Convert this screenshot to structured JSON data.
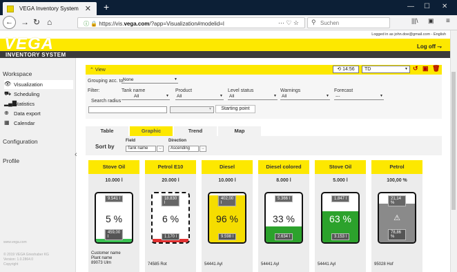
{
  "browser": {
    "tab_title": "VEGA Inventory System",
    "tab_close": "✕",
    "new_tab": "+",
    "url_prefix": "https://vis.",
    "url_domain": "vega.com",
    "url_path": "/?app=Visualization#modelid=l",
    "search_placeholder": "Suchen",
    "min": "—",
    "max": "☐",
    "close": "✕"
  },
  "header": {
    "logged_in": "Logged in as john.doe@gmail.com - English",
    "logo": "VEGA",
    "logoff": "Log off",
    "app_title": "INVENTORY SYSTEM"
  },
  "sidebar": {
    "workspace": "Workspace",
    "items": [
      {
        "label": "Visualization",
        "icon": "eye-icon"
      },
      {
        "label": "Scheduling",
        "icon": "truck-icon"
      },
      {
        "label": "Statistics",
        "icon": "bar-chart-icon"
      },
      {
        "label": "Data export",
        "icon": "export-icon"
      },
      {
        "label": "Calendar",
        "icon": "calendar-icon"
      }
    ],
    "configuration": "Configuration",
    "profile": "Profile",
    "footer_url": "www.vega.com",
    "footer_copy": "© 2019 VEGA Grieshaber KG",
    "footer_version": "Version: 1.0.2864.0",
    "footer_copyright": "Copyright"
  },
  "view": {
    "title": "View",
    "time": "14:56",
    "td_value": "TD",
    "grouping_label": "Grouping acc. to:",
    "grouping_value": "None",
    "filter_label": "Filter:",
    "tank_name": "Tank name",
    "product": "Product",
    "level_status": "Level status",
    "warnings": "Warnings",
    "forecast": "Forecast",
    "all": "All",
    "forecast_value": "---",
    "search_radius": "Search radius",
    "starting_point": "Starting point"
  },
  "tabs": [
    "Table",
    "Graphic",
    "Trend",
    "Map"
  ],
  "sort": {
    "label": "Sort by",
    "field_head": "Field",
    "field_value": "Tank name",
    "direction_head": "Direction",
    "direction_value": "Ascending"
  },
  "tanks": [
    {
      "name": "Stove Oil",
      "volume": "10.000 l",
      "percent": "5 %",
      "top": "9.541 l",
      "bottom": "459,00 l",
      "fill_fraction": 0.05,
      "fill_color": "#ffffff",
      "bar_color": "#38c050",
      "customer": "Customer name",
      "plant": "Plant name",
      "address": "89073 Ulm"
    },
    {
      "name": "Petrol E10",
      "volume": "20.000 l",
      "percent": "6 %",
      "top": "18.830 l",
      "bottom": "1.170 l",
      "fill_fraction": 0.06,
      "fill_color": "#ffffff",
      "bar_color": "#e03030",
      "address": "74585 Rot"
    },
    {
      "name": "Diesel",
      "volume": "10.000 l",
      "percent": "96 %",
      "top": "402,00 l",
      "bottom": "9.598 l",
      "fill_fraction": 0.96,
      "fill_color": "#f5dd00",
      "address": "54441 Ayl"
    },
    {
      "name": "Diesel colored",
      "volume": "8.000 l",
      "percent": "33 %",
      "top": "5.366 l",
      "bottom": "2.634 l",
      "fill_fraction": 0.33,
      "fill_color": "#2ca22c",
      "address": "54441 Ayl"
    },
    {
      "name": "Stove Oil",
      "volume": "5.000 l",
      "percent": "63 %",
      "top": "1.847 l",
      "bottom": "3.153 l",
      "fill_fraction": 0.63,
      "fill_color": "#2ca22c",
      "address": "54441 Ayl"
    },
    {
      "name": "Petrol",
      "volume": "100,00 %",
      "percent": "",
      "top": "21,14 %",
      "bottom": "78,86 %",
      "fill_fraction": 0.79,
      "fill_color": "#8a8a8a",
      "warning": "⚠",
      "address": "95028 Hof"
    }
  ]
}
